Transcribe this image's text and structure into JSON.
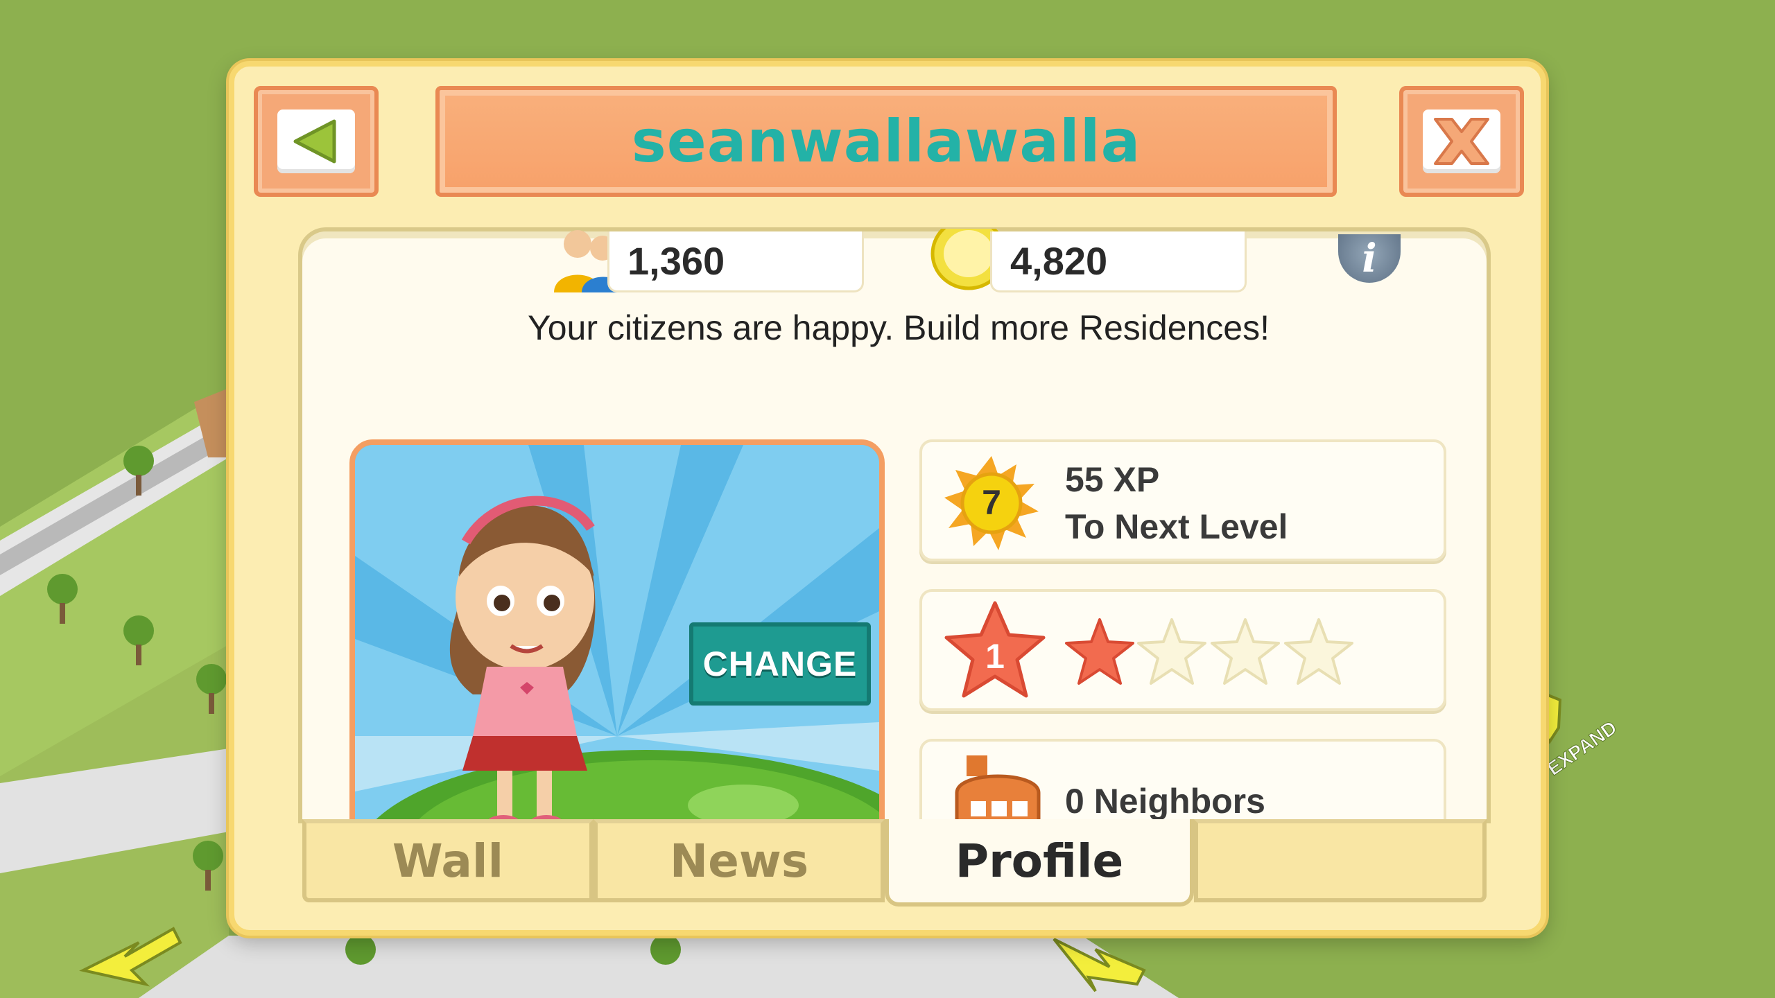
{
  "header": {
    "username": "seanwallawalla"
  },
  "stats": {
    "population": "1,360",
    "coins": "4,820"
  },
  "message": "Your citizens are happy. Build more Residences!",
  "avatar": {
    "change_label": "CHANGE"
  },
  "cards": {
    "level": "7",
    "xp_line1": "55 XP",
    "xp_line2": "To Next Level",
    "rank": "1",
    "rank_stars_filled": 1,
    "rank_stars_total": 4,
    "neighbors": "0 Neighbors"
  },
  "tabs": [
    {
      "label": "Wall",
      "active": false
    },
    {
      "label": "News",
      "active": false
    },
    {
      "label": "Profile",
      "active": true
    }
  ],
  "map": {
    "expand_label": "EXPAND"
  },
  "colors": {
    "title_teal": "#23b2a7",
    "orange": "#f5a877",
    "panel": "#fcedb2",
    "grass": "#8db04f"
  }
}
